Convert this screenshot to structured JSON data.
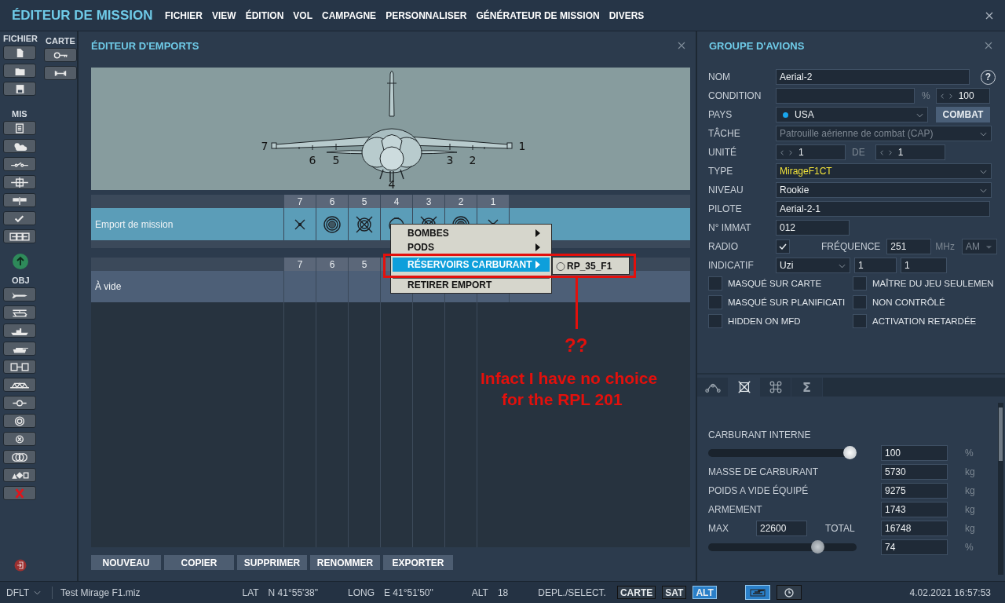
{
  "title": "ÉDITEUR DE MISSION",
  "menu": [
    "FICHIER",
    "VIEW",
    "ÉDITION",
    "VOL",
    "CAMPAGNE",
    "PERSONNALISER",
    "GÉNÉRATEUR DE MISSION",
    "DIVERS"
  ],
  "toolbar": {
    "file_label": "FICHIER",
    "map_label": "CARTE",
    "mission_label": "MIS",
    "objects_label": "OBJ"
  },
  "loadout_editor": {
    "title": "ÉDITEUR D'EMPORTS",
    "diagram_stations": [
      "7",
      "6",
      "5",
      "4",
      "3",
      "2",
      "1"
    ],
    "loadout_table": {
      "columns": [
        "7",
        "6",
        "5",
        "4",
        "3",
        "2",
        "1"
      ],
      "rows": [
        {
          "name": "Emport de mission",
          "selected": true,
          "stations": [
            {
              "kind": "missile"
            },
            {
              "kind": "pod"
            },
            {
              "kind": "rack"
            },
            {
              "kind": "tank"
            },
            {
              "kind": "rack"
            },
            {
              "kind": "pod"
            },
            {
              "kind": "missile"
            }
          ]
        }
      ]
    },
    "empty_table": {
      "columns": [
        "7",
        "6",
        "5"
      ],
      "rows": [
        {
          "name": "À vide",
          "selected": false
        }
      ]
    },
    "buttons": [
      "NOUVEAU",
      "COPIER",
      "SUPPRIMER",
      "RENOMMER",
      "EXPORTER"
    ]
  },
  "context_menu": {
    "items": [
      {
        "label": "BOMBES",
        "submenu": true,
        "selected": false
      },
      {
        "label": "PODS",
        "submenu": true,
        "selected": false
      },
      {
        "label": "RÉSERVOIRS CARBURANT",
        "submenu": true,
        "selected": true
      },
      {
        "label": "RETIRER EMPORT",
        "submenu": false,
        "selected": false
      }
    ],
    "submenu_items": [
      "RP_35_F1"
    ]
  },
  "annotation": {
    "marks": "??",
    "note_lines": [
      "Infact I have no choice",
      "for the RPL 201"
    ]
  },
  "aircraft_group": {
    "title": "GROUPE D'AVIONS",
    "help": "?",
    "name": {
      "label": "NOM",
      "value": "Aerial-2"
    },
    "condition": {
      "label": "CONDITION",
      "unit": "%",
      "probability": "100"
    },
    "country": {
      "label": "PAYS",
      "value": "USA",
      "color": "#19a6ee",
      "button": "COMBAT"
    },
    "task": {
      "label": "TÂCHE",
      "value": "Patrouille aérienne de combat (CAP)",
      "disabled": true
    },
    "unit": {
      "label": "UNITÉ",
      "value": "1",
      "of_label": "DE",
      "of_value": "1"
    },
    "type": {
      "label": "TYPE",
      "value": "MirageF1CT"
    },
    "skill": {
      "label": "NIVEAU",
      "value": "Rookie"
    },
    "pilot": {
      "label": "PILOTE",
      "value": "Aerial-2-1"
    },
    "tail_number": {
      "label": "N° IMMAT",
      "value": "012"
    },
    "radio": {
      "label": "RADIO",
      "checked": true,
      "frequency_label": "FRÉQUENCE",
      "frequency": "251",
      "unit": "MHz",
      "modulation": "AM",
      "modulation_disabled": true
    },
    "callsign": {
      "label": "INDICATIF",
      "value": "Uzi",
      "number_1": "1",
      "number_2": "1"
    },
    "flags": [
      {
        "label": "MASQUÉ SUR CARTE",
        "checked": false
      },
      {
        "label": "MAÎTRE DU JEU SEULEMEN",
        "checked": false
      },
      {
        "label": "MASQUÉ SUR PLANIFICATI",
        "checked": false
      },
      {
        "label": "NON CONTRÔLÉ",
        "checked": false
      },
      {
        "label": "HIDDEN ON MFD",
        "checked": false
      },
      {
        "label": "ACTIVATION RETARDÉE",
        "checked": false
      }
    ],
    "tabs": [
      {
        "kind": "route",
        "selected": false
      },
      {
        "kind": "payload",
        "selected": true
      },
      {
        "kind": "command",
        "selected": false
      },
      {
        "kind": "summary",
        "label": "Σ",
        "selected": false
      }
    ],
    "fuel": {
      "internal_label": "CARBURANT INTERNE",
      "internal_slider": {
        "level": 1.0
      },
      "internal_value": "100",
      "internal_unit": "%",
      "rows": [
        {
          "label": "MASSE DE CARBURANT",
          "value": "5730",
          "unit": "kg"
        },
        {
          "label": "POIDS A VIDE ÉQUIPÉ",
          "value": "9275",
          "unit": "kg"
        },
        {
          "label": "ARMEMENT",
          "value": "1743",
          "unit": "kg"
        }
      ],
      "max_label": "MAX",
      "max_value": "22600",
      "total_label": "TOTAL",
      "total_value": "16748",
      "total_unit": "kg",
      "load_slider": {
        "level": 0.74
      },
      "load_value": "74",
      "load_unit": "%"
    }
  },
  "status_bar": {
    "profile": "DFLT",
    "file": "Test Mirage F1.miz",
    "lat_label": "LAT",
    "lat": "N 41°55'38\"",
    "long_label": "LONG",
    "long": "E 41°51'50\"",
    "alt_label": "ALT",
    "alt": "18",
    "mode": "DEPL./SELECT.",
    "map_modes": [
      {
        "label": "CARTE",
        "selected": false
      },
      {
        "label": "SAT",
        "selected": false
      },
      {
        "label": "ALT",
        "selected": true
      }
    ],
    "view_toggles": [
      {
        "selected": true
      },
      {
        "selected": false
      }
    ],
    "datetime": "4.02.2021 16:57:53"
  }
}
